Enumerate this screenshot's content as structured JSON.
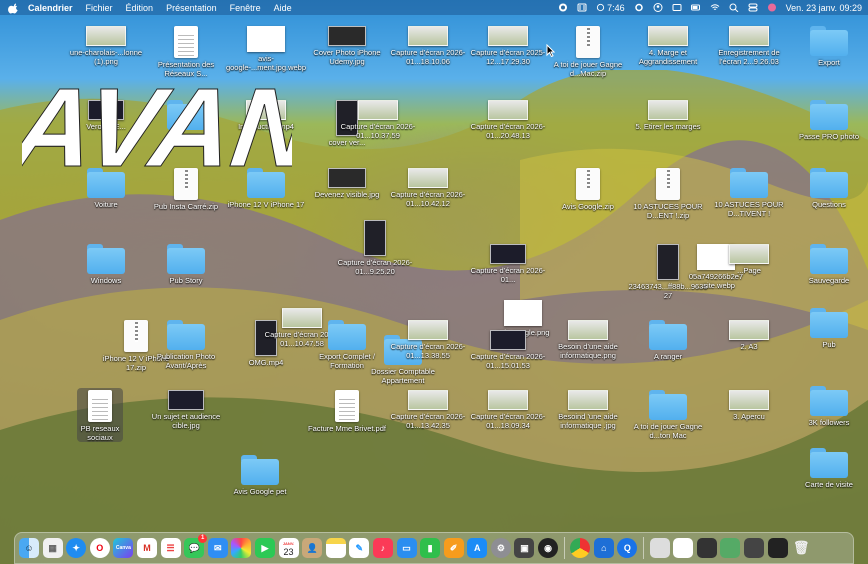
{
  "menubar": {
    "app": "Calendrier",
    "menus": [
      "Fichier",
      "Édition",
      "Présentation",
      "Fenêtre",
      "Aide"
    ],
    "clock_extra": "7:46",
    "datetime": "Ven. 23 janv.  09:29"
  },
  "overlay_text": "AVANT",
  "desktop": [
    {
      "label": "une-charolais-...lonne (1).png"
    },
    {
      "label": "Présentation des Réseaux S..."
    },
    {
      "label": "avis-google-...ment.jpg.webp"
    },
    {
      "label": "Cover Photo iPhone Udemy.jpg"
    },
    {
      "label": "Capture d’écran 2026-01...18.10.06"
    },
    {
      "label": "Capture d’écran 2025-12...17.29.30"
    },
    {
      "label": "A toi de jouer Gagne d...Mac.zip"
    },
    {
      "label": "4. Marge et Aggrandissement"
    },
    {
      "label": "Enregistrement de l’écran 2...9.26.03"
    },
    {
      "label": "Export"
    },
    {
      "label": "Vero... AE..."
    },
    {
      "label": "...nstar"
    },
    {
      "label": "Introduction.mp4"
    },
    {
      "label": "cover ver..."
    },
    {
      "label": "Capture d’écran 2026-01...10.37.59"
    },
    {
      "label": "Capture d’écran 2026-01...20.48.13"
    },
    {
      "label": "5. Etirer les marges"
    },
    {
      "label": "Passe PRO photo"
    },
    {
      "label": "Voiture"
    },
    {
      "label": "Pub Insta Carré.zip"
    },
    {
      "label": "iPhone 12 V iPhone 17"
    },
    {
      "label": "Devenez visible.jpg"
    },
    {
      "label": "Capture d’écran 2026-01...10.42.12"
    },
    {
      "label": "Avis Google.zip"
    },
    {
      "label": "10 ASTUCES POUR D...ENT !.zip"
    },
    {
      "label": "10 ASTUCES POUR D...TIVENT !"
    },
    {
      "label": "Questions"
    },
    {
      "label": "Capture d’écran 2026-01...9.25.20"
    },
    {
      "label": "Windows"
    },
    {
      "label": "Pub Story"
    },
    {
      "label": "Capture d’écran 2026-01..."
    },
    {
      "label": "23463743...ff88b...963627"
    },
    {
      "label": "05a749266b2e7 ...site.webp"
    },
    {
      "label": "...Page"
    },
    {
      "label": "Sauvegarde"
    },
    {
      "label": "iPhone 12 V iPhone 17.zip"
    },
    {
      "label": "Publication Photo Avant/Après"
    },
    {
      "label": "OMG.mp4"
    },
    {
      "label": "Capture d’écran 2026-01...10.47.58"
    },
    {
      "label": "Export Complet / Formation"
    },
    {
      "label": "Dossier Comptable Appartement"
    },
    {
      "label": "Capture d’écran 2026-01...13.38.55"
    },
    {
      "label": "avis-google.png"
    },
    {
      "label": "Capture d’écran 2026-01...15.01.53"
    },
    {
      "label": "Besoin d’une aide informatique.png"
    },
    {
      "label": "A ranger"
    },
    {
      "label": "2. A3"
    },
    {
      "label": "Pub"
    },
    {
      "label": "PB reseaux sociaux"
    },
    {
      "label": "Un sujet et audience cible.jpg"
    },
    {
      "label": "Facture Mme Brivet.pdf"
    },
    {
      "label": "Capture d’écran 2026-01...13.42.35"
    },
    {
      "label": "Capture d’écran 2026-01...18.09.34"
    },
    {
      "label": "Besoind 'une aide informatique .jpg"
    },
    {
      "label": "A toi de jouer Gagne d...ton Mac"
    },
    {
      "label": "3. Apercu"
    },
    {
      "label": "3K followers"
    },
    {
      "label": "Avis Google pet"
    },
    {
      "label": "Carte de visite"
    }
  ],
  "dock": {
    "calendar_day": "23",
    "calendar_month": "JANV.",
    "canva": "Canva",
    "messages_badge": "1"
  }
}
